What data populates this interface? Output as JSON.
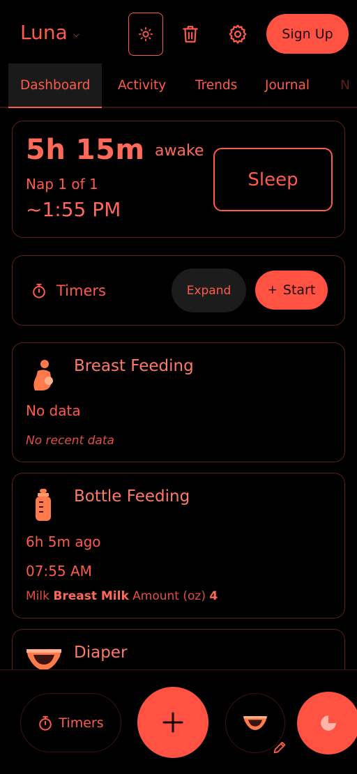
{
  "header": {
    "profile_name": "Luna",
    "signup_label": "Sign Up",
    "icons": [
      "chevron-down-icon",
      "sun-icon",
      "trash-icon",
      "gear-icon"
    ]
  },
  "tabs": [
    {
      "label": "Dashboard",
      "active": true
    },
    {
      "label": "Activity",
      "active": false
    },
    {
      "label": "Trends",
      "active": false
    },
    {
      "label": "Journal",
      "active": false
    },
    {
      "label": "N",
      "active": false
    }
  ],
  "awake": {
    "duration": "5h 15m",
    "state": "awake",
    "nap_label": "Nap 1 of 1",
    "nap_time": "~1:55 PM",
    "sleep_label": "Sleep"
  },
  "timers": {
    "label": "Timers",
    "expand_label": "Expand",
    "start_label": "Start",
    "start_plus": "+"
  },
  "breast_feeding": {
    "title": "Breast Feeding",
    "status": "No data",
    "subtitle": "No recent data"
  },
  "bottle_feeding": {
    "title": "Bottle Feeding",
    "ago": "6h 5m ago",
    "time": "07:55 AM",
    "milk_label": "Milk",
    "milk_value": "Breast Milk",
    "amount_label": "Amount (oz)",
    "amount_value": "4"
  },
  "diaper": {
    "title": "Diaper"
  },
  "bottom_bar": {
    "timers_label": "Timers"
  },
  "colors": {
    "accent": "#ff5b4a",
    "button_fill": "#ff5242",
    "background": "#000000",
    "card_border": "#5a2118"
  }
}
